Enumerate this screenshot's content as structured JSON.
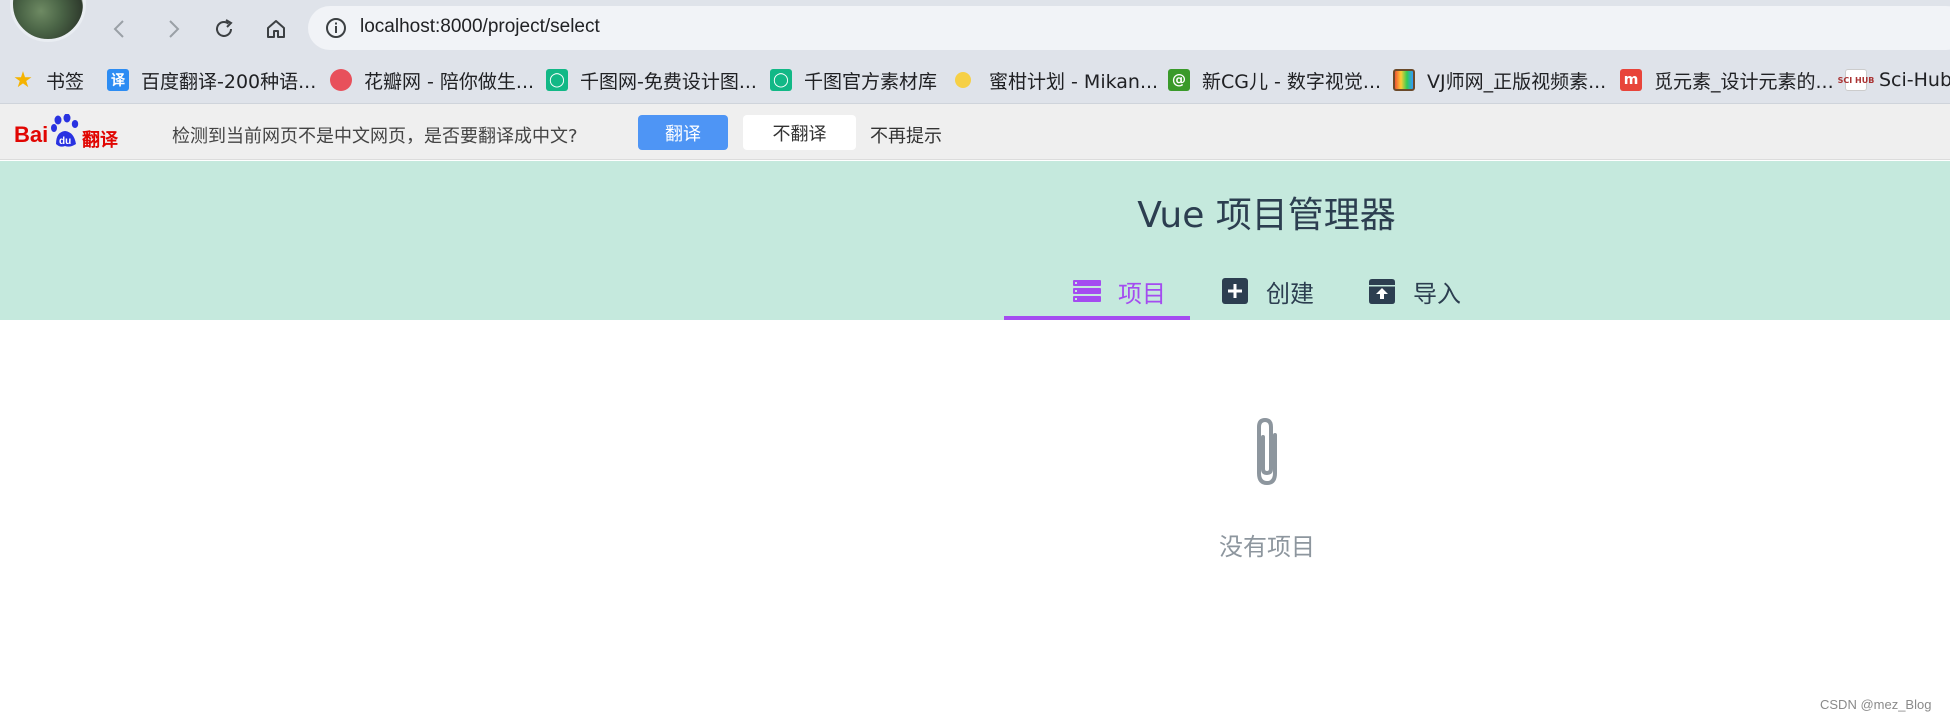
{
  "browser": {
    "url": "localhost:8000/project/select",
    "icons": {
      "back": "back-arrow-icon",
      "forward": "forward-arrow-icon",
      "reload": "reload-icon",
      "home": "home-icon",
      "info": "info-icon"
    }
  },
  "bookmarks": [
    {
      "label": "书签",
      "icon": "star-icon",
      "color": "#f5b300"
    },
    {
      "label": "百度翻译-200种语...",
      "icon": "translate-icon",
      "color": "#2c8cf3"
    },
    {
      "label": "花瓣网 - 陪你做生...",
      "icon": "huaban-icon",
      "color": "#e8505b"
    },
    {
      "label": "千图网-免费设计图...",
      "icon": "qiantu-icon",
      "color": "#12b886"
    },
    {
      "label": "千图官方素材库",
      "icon": "qiantu-icon",
      "color": "#12b886"
    },
    {
      "label": "蜜柑计划 - Mikan...",
      "icon": "mikan-icon",
      "color": "#f6d046"
    },
    {
      "label": "新CG儿 - 数字视觉...",
      "icon": "cg-icon",
      "color": "#3a9a2a"
    },
    {
      "label": "VJ师网_正版视频素...",
      "icon": "tv-icon",
      "color": "#6b4a2a"
    },
    {
      "label": "觅元素_设计元素的...",
      "icon": "mi-icon",
      "color": "#e8443a"
    },
    {
      "label": "Sci-Hub",
      "icon": "scihub-icon",
      "color": "#a33",
      "icon_text": "SCI HUB"
    }
  ],
  "translate_bar": {
    "logo_text_bai": "Bai",
    "logo_text_du": "du",
    "logo_text_fanyi": "翻译",
    "message": "检测到当前网页不是中文网页，是否要翻译成中文?",
    "translate_button": "翻译",
    "no_translate_button": "不翻译",
    "no_more_link": "不再提示"
  },
  "app": {
    "title": "Vue 项目管理器",
    "tabs": [
      {
        "label": "项目",
        "icon": "list-icon",
        "active": true
      },
      {
        "label": "创建",
        "icon": "plus-square-icon",
        "active": false
      },
      {
        "label": "导入",
        "icon": "import-box-icon",
        "active": false
      }
    ],
    "empty_state": {
      "icon": "paperclip-icon",
      "text": "没有项目"
    },
    "accent_color": "#a44cf0",
    "header_color": "#c5e9dd"
  },
  "watermark": "CSDN @mez_Blog"
}
